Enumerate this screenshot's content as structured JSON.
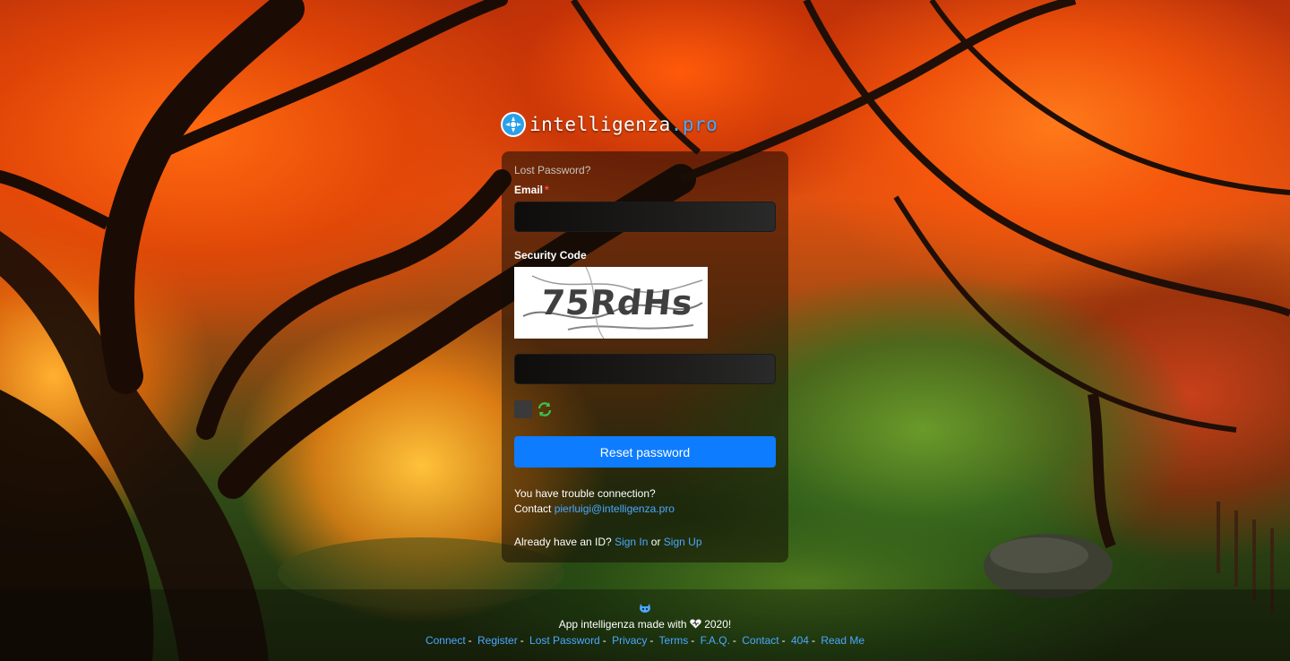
{
  "brand": {
    "name": "intelligenza",
    "tld": ".pro"
  },
  "form": {
    "title": "Lost Password?",
    "email_label": "Email",
    "required_mark": "*",
    "email_value": "",
    "security_label": "Security Code",
    "captcha_text": "75RdHs",
    "security_value": "",
    "submit_label": "Reset password"
  },
  "help": {
    "line1": "You have trouble connection?",
    "contact_prefix": "Contact",
    "contact_email": "pierluigi@intelligenza.pro"
  },
  "account": {
    "prefix": "Already have an ID?",
    "sign_in": "Sign In",
    "or": "or",
    "sign_up": "Sign Up"
  },
  "footer": {
    "credit_prefix": "App intelligenza made with",
    "credit_suffix": "2020!",
    "links": [
      "Connect",
      "Register",
      "Lost Password",
      "Privacy",
      "Terms",
      "F.A.Q.",
      "Contact",
      "404",
      "Read Me"
    ]
  },
  "colors": {
    "accent": "#0d7cff",
    "link": "#4aa8ff",
    "required": "#ff4d4f"
  },
  "icons": [
    "logo-icon",
    "refresh-icon",
    "heart-icon",
    "github-icon"
  ]
}
